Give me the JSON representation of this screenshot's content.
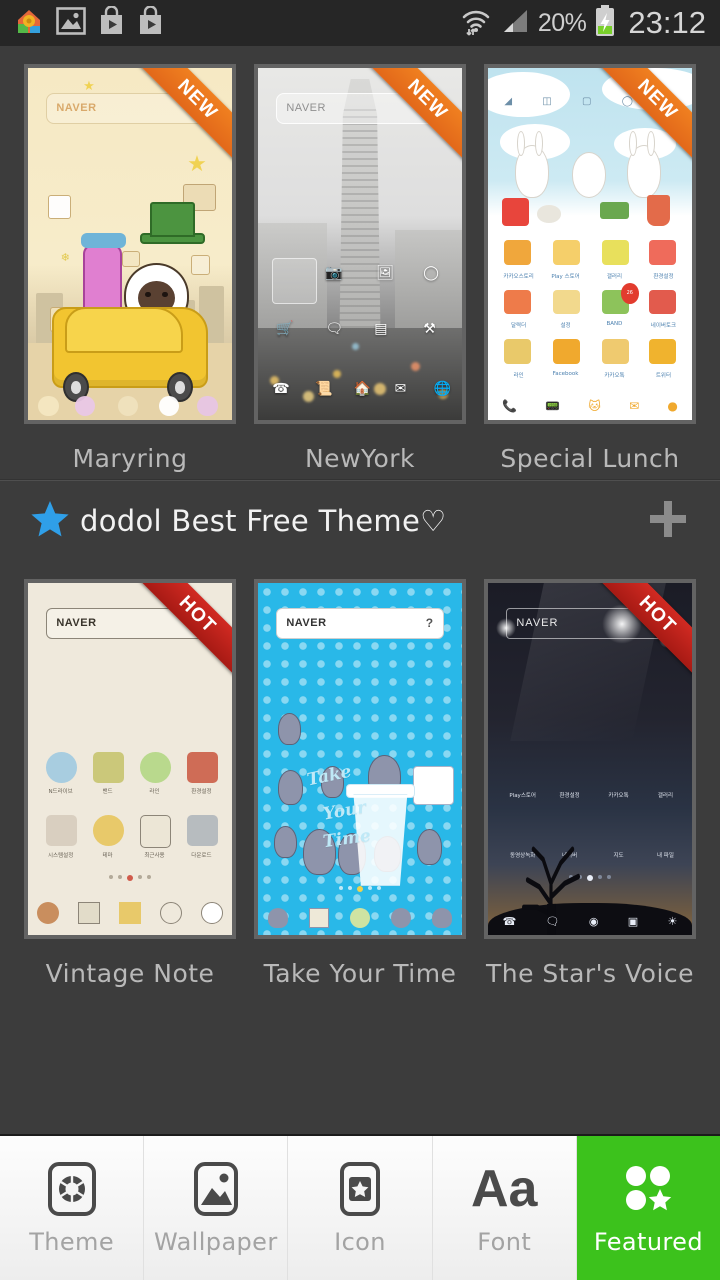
{
  "statusbar": {
    "left_icons": [
      "home-settings-app-icon",
      "gallery-icon",
      "play-store-icon",
      "play-store-icon-2"
    ],
    "wifi_icon": "wifi-icon",
    "signal_icon": "signal-bars-icon",
    "battery_percent": "20%",
    "battery_icon": "battery-charging-icon",
    "clock": "23:12"
  },
  "top_section": {
    "themes": [
      {
        "name": "Maryring",
        "badge": "NEW",
        "badge_color": "#ea6f1c",
        "search_label": "NAVER"
      },
      {
        "name": "NewYork",
        "badge": "NEW",
        "badge_color": "#ea6f1c",
        "search_label": "NAVER"
      },
      {
        "name": "Special Lunch",
        "badge": "NEW",
        "badge_color": "#ea6f1c",
        "search_label": ""
      }
    ]
  },
  "best_free_section": {
    "star_icon": "star-icon",
    "star_color": "#2f9fe8",
    "title": "dodol Best Free Theme♡",
    "plus_icon": "plus-icon",
    "themes": [
      {
        "name": "Vintage Note",
        "badge": "HOT",
        "badge_color": "#bf2119",
        "search_label": "NAVER"
      },
      {
        "name": "Take Your Time",
        "badge": "",
        "badge_color": "",
        "search_label": "NAVER"
      },
      {
        "name": "The Star's Voice",
        "badge": "HOT",
        "badge_color": "#bf2119",
        "search_label": "NAVER"
      }
    ]
  },
  "special_lunch_icons": {
    "row1": [
      "카카오스토리",
      "Play 스토어",
      "갤러리",
      "환경설정"
    ],
    "row2": [
      "달력더",
      "설정",
      "BAND",
      "네이버토크"
    ],
    "row3": [
      "라인",
      "Facebook",
      "카카오톡",
      "트위터"
    ],
    "badge_count": "26"
  },
  "vintage_icons": {
    "row1": [
      "N드라이브",
      "밴드",
      "라인",
      "환경설정"
    ],
    "row2": [
      "시스템설정",
      "테마",
      "최근사용",
      "다운로드"
    ]
  },
  "star_icons": {
    "row1": [
      "Play스토어",
      "환경설정",
      "카카오톡",
      "갤러리"
    ],
    "row2": [
      "동영상녹화",
      "네이버",
      "지도",
      "내 파일"
    ]
  },
  "bottom_nav": {
    "items": [
      {
        "label": "Theme",
        "icon": "theme-icon",
        "active": false
      },
      {
        "label": "Wallpaper",
        "icon": "wallpaper-icon",
        "active": false
      },
      {
        "label": "Icon",
        "icon": "icon-pack-icon",
        "active": false
      },
      {
        "label": "Font",
        "icon": "font-icon",
        "active": false
      },
      {
        "label": "Featured",
        "icon": "featured-icon",
        "active": true
      }
    ],
    "active_color": "#3cc21c"
  }
}
